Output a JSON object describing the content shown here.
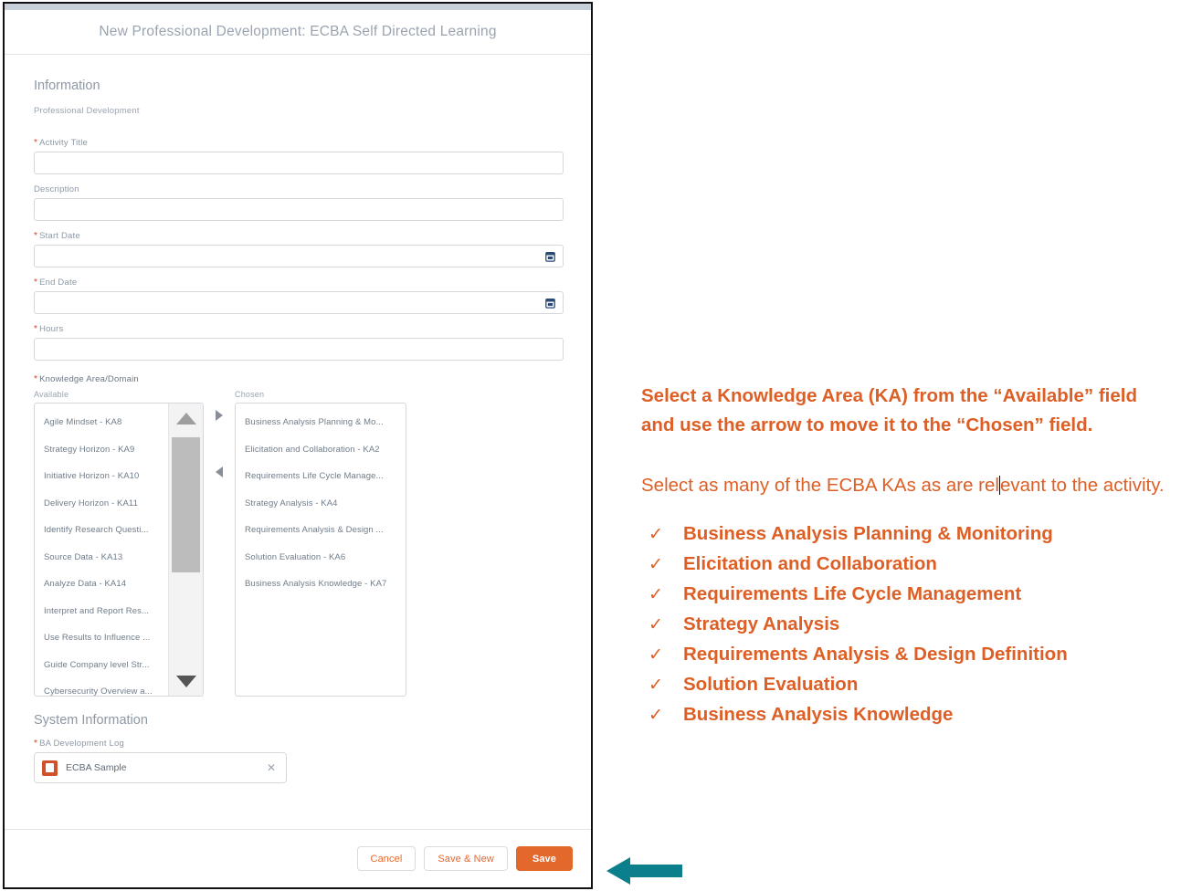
{
  "modal": {
    "title": "New Professional Development: ECBA Self Directed Learning",
    "information_heading": "Information",
    "information_sublabel": "Professional Development",
    "fields": [
      {
        "label": "Activity Title",
        "required": true,
        "value": "",
        "icon": ""
      },
      {
        "label": "Description",
        "required": false,
        "value": "",
        "icon": ""
      },
      {
        "label": "Start Date",
        "required": true,
        "value": "",
        "icon": "calendar-icon"
      },
      {
        "label": "End Date",
        "required": true,
        "value": "",
        "icon": "calendar-icon"
      },
      {
        "label": "Hours",
        "required": true,
        "value": "",
        "icon": ""
      }
    ],
    "dual_listbox": {
      "label": "Knowledge Area/Domain",
      "required": true,
      "available_label": "Available",
      "chosen_label": "Chosen",
      "available": [
        "Agile Mindset - KA8",
        "Strategy Horizon - KA9",
        "Initiative Horizon - KA10",
        "Delivery Horizon - KA11",
        "Identify Research Questi...",
        "Source Data - KA13",
        "Analyze Data - KA14",
        "Interpret and Report Res...",
        "Use Results to Influence ...",
        "Guide Company level Str...",
        "Cybersecurity Overview a..."
      ],
      "chosen": [
        "Business Analysis Planning & Mo...",
        "Elicitation and Collaboration - KA2",
        "Requirements Life Cycle Manage...",
        "Strategy Analysis - KA4",
        "Requirements Analysis & Design ...",
        "Solution Evaluation - KA6",
        "Business Analysis Knowledge - KA7"
      ],
      "move_right_icon": "caret-right-icon",
      "move_left_icon": "caret-left-icon",
      "scroll_up_icon": "triangle-up-icon",
      "scroll_down_icon": "triangle-down-icon"
    },
    "system_information": {
      "heading": "System Information",
      "log_label": "BA Development Log",
      "log_required": true,
      "log_value": "ECBA Sample",
      "remove_icon": "close-icon",
      "record_icon": "record-icon"
    },
    "footer": {
      "cancel_label": "Cancel",
      "save_new_label": "Save & New",
      "save_label": "Save"
    }
  },
  "notes": {
    "paragraph_1": "Select a  Knowledge Area (KA) from the “Available” field and use the arrow to move it to the “Chosen” field.",
    "paragraph_2a": "Select as many of the ECBA KAs as are rel",
    "paragraph_2b": "evant to the activity.",
    "check_icon": "check-mark-icon",
    "checklist": [
      "Business Analysis Planning & Monitoring",
      "Elicitation and Collaboration",
      "Requirements Life Cycle Management",
      "Strategy Analysis",
      "Requirements Analysis & Design Definition",
      "Solution Evaluation",
      "Business Analysis Knowledge"
    ]
  },
  "annotation": {
    "arrow_icon": "left-arrow-icon",
    "arrow_color": "#0b7f8c"
  },
  "colors": {
    "accent_orange": "#dd5f26",
    "save_button": "#e2682b",
    "required_red": "#e03b24",
    "teal": "#0b7f8c",
    "label_gray": "#8d98a5"
  }
}
